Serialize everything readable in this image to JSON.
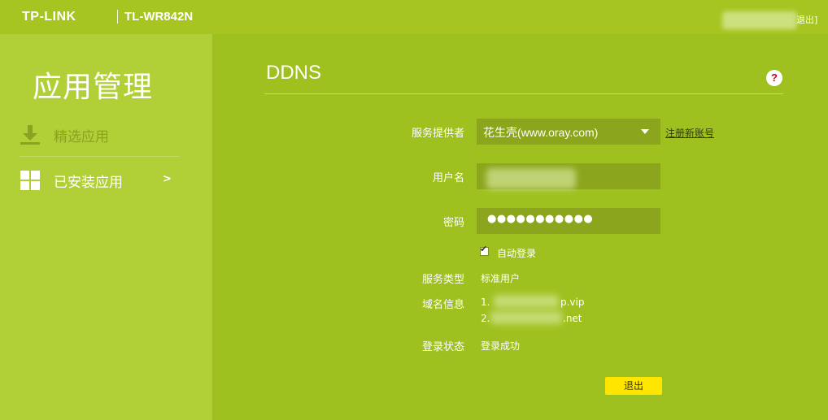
{
  "header": {
    "brand": "TP-LINK",
    "model": "TL-WR842N",
    "logout_link": "退出]"
  },
  "sidebar": {
    "title": "应用管理",
    "items": [
      {
        "label": "精选应用",
        "icon": "download-icon"
      },
      {
        "label": "已安装应用",
        "icon": "grid-icon",
        "arrow": ">"
      }
    ]
  },
  "main": {
    "title": "DDNS",
    "help": "?",
    "form": {
      "provider_label": "服务提供者",
      "provider_value": "花生壳(www.oray.com)",
      "register_link": "注册新账号",
      "username_label": "用户名",
      "password_label": "密码",
      "password_value": "●●●●●●●●●●●",
      "auto_login_label": "自动登录",
      "auto_login_checked": true,
      "service_type_label": "服务类型",
      "service_type_value": "标准用户",
      "domain_label": "域名信息",
      "domain_1_prefix": "1. ",
      "domain_1_suffix": "p.vip",
      "domain_2_prefix": "2.",
      "domain_2_suffix": ".net",
      "status_label": "登录状态",
      "status_value": "登录成功",
      "logout_button": "退出"
    }
  },
  "colors": {
    "background": "#9fc120",
    "sidebar": "#b1cf36",
    "field": "#8ba51c",
    "button": "#ffe600",
    "help_icon": "#d0021b"
  }
}
